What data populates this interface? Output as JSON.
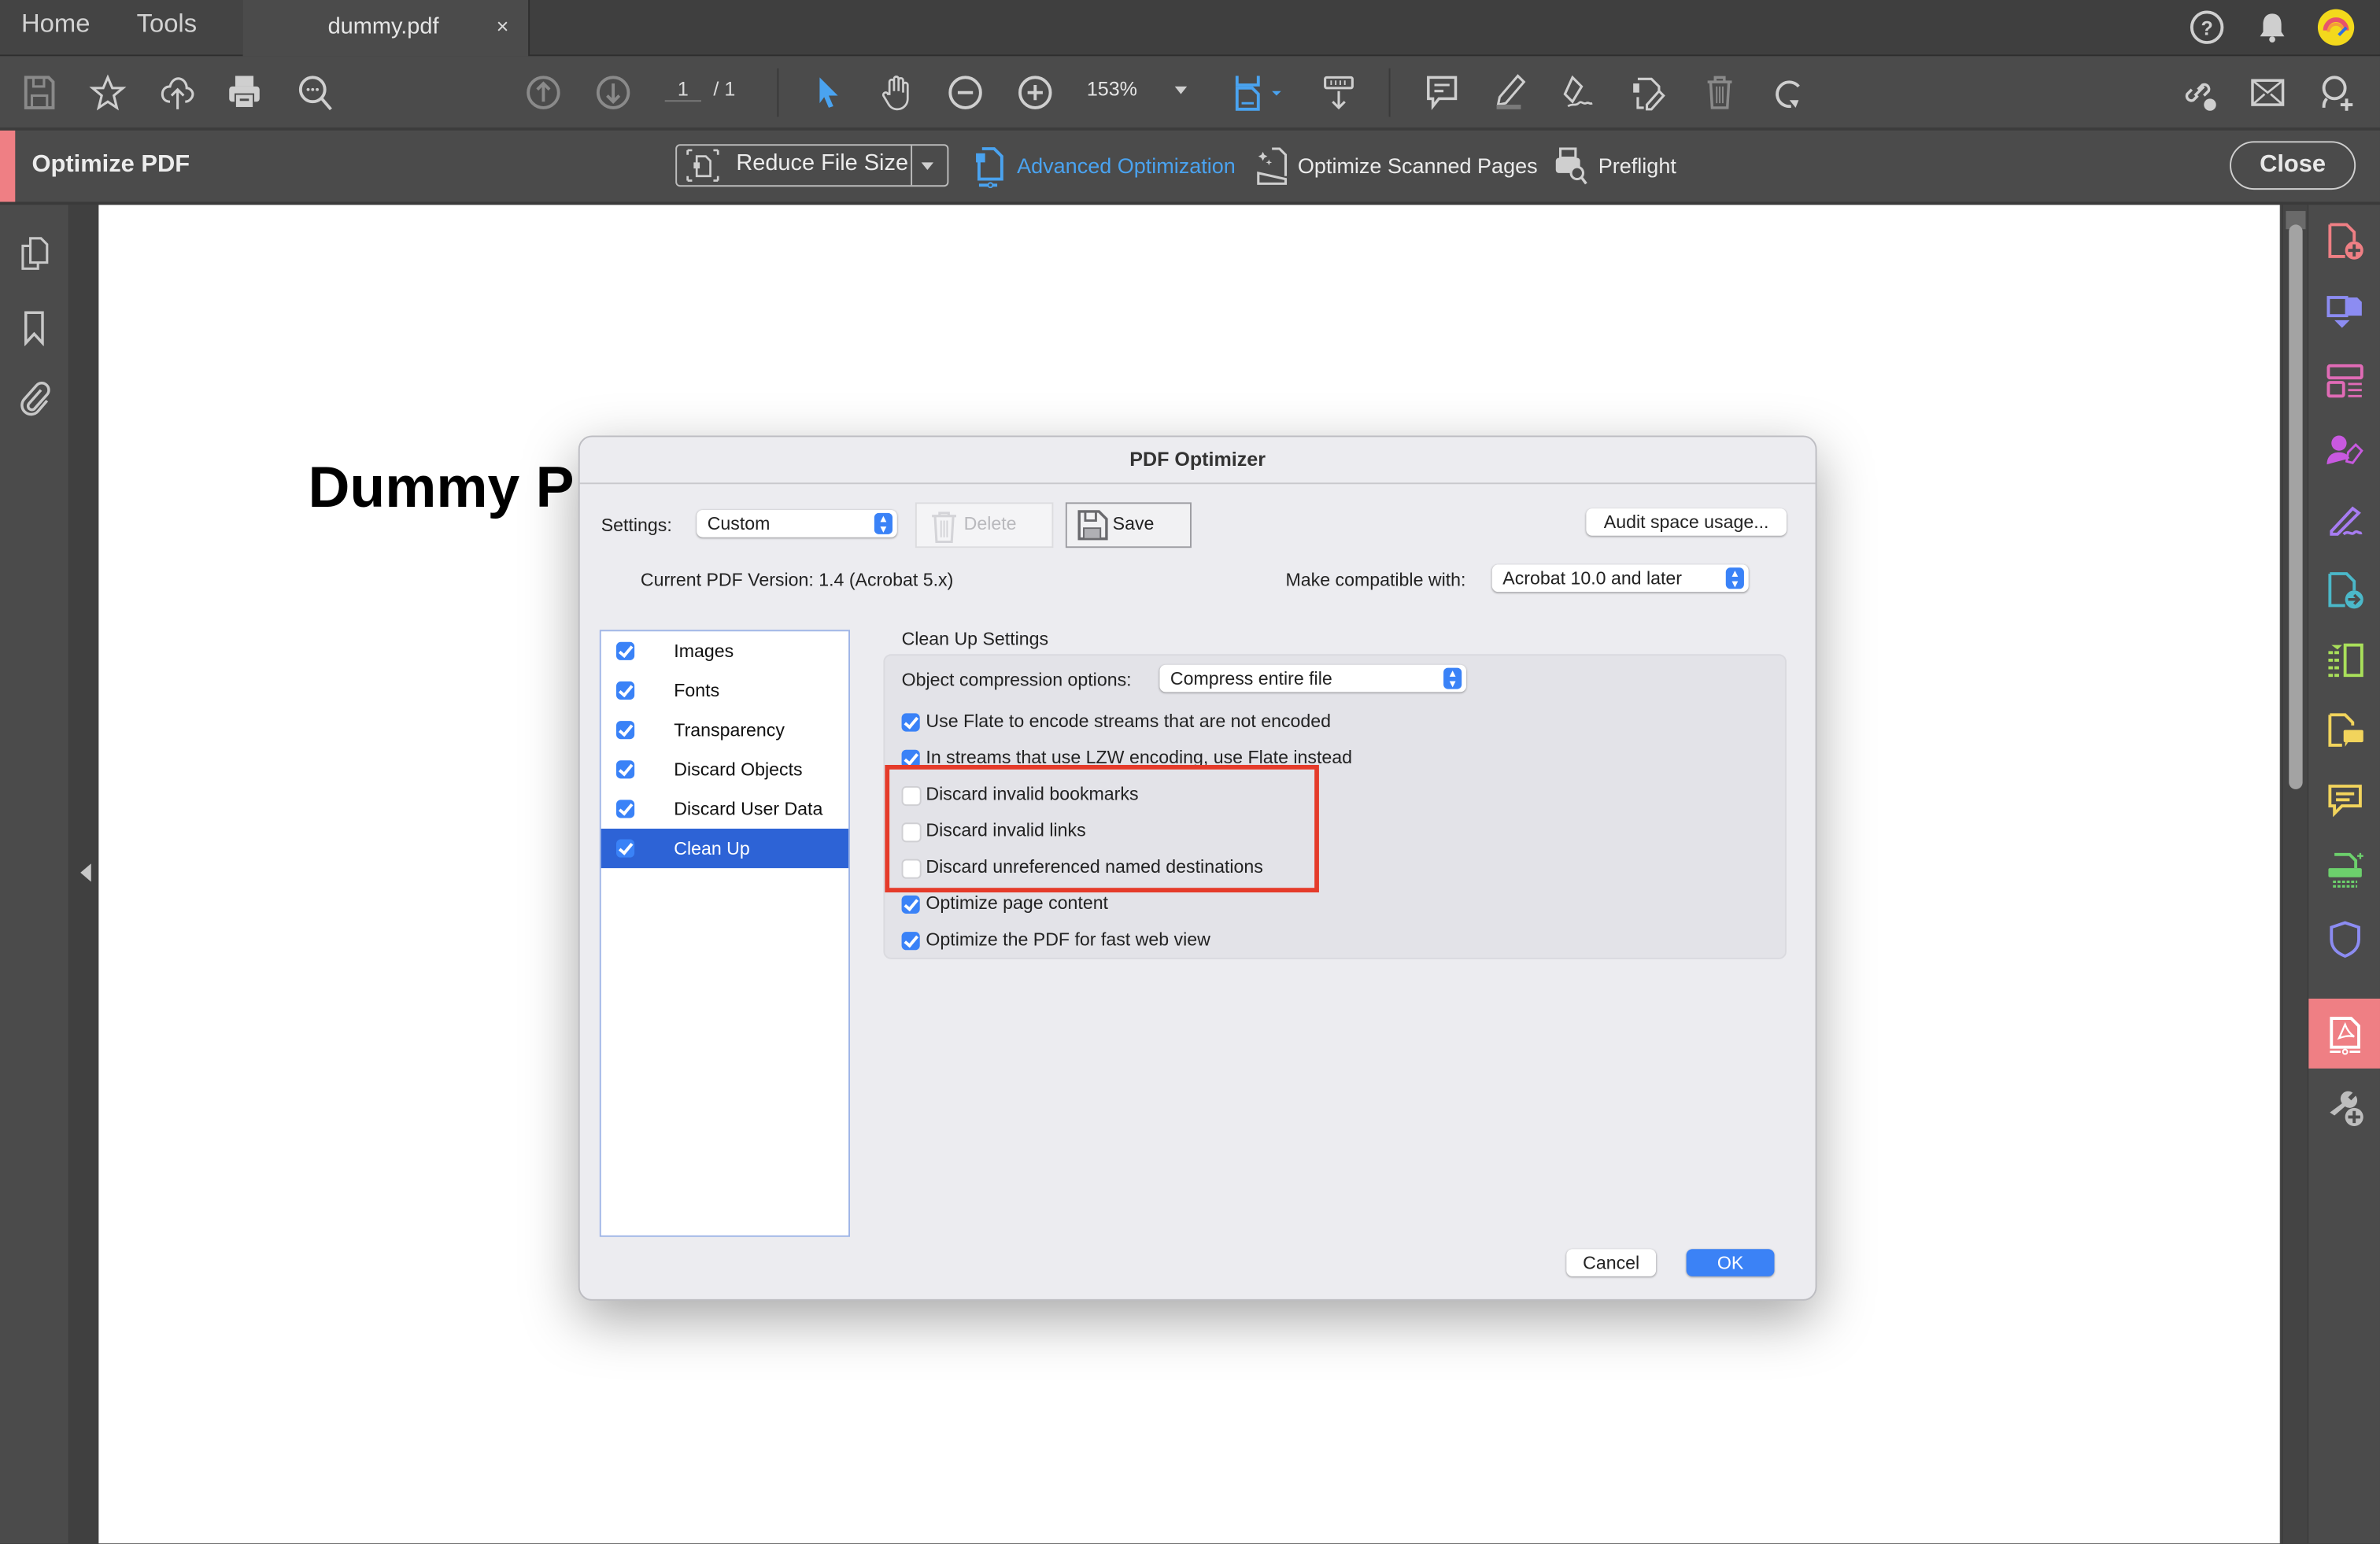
{
  "tabbar": {
    "home": "Home",
    "tools": "Tools",
    "document_tab": "dummy.pdf",
    "close_tab": "×",
    "right_icons": [
      "help-icon",
      "bell-icon",
      "account-avatar"
    ]
  },
  "toolbar": {
    "left_icons": [
      "save-icon",
      "star-icon",
      "cloud-upload-icon",
      "print-icon",
      "find-icon"
    ],
    "page_current": "1",
    "page_total": "/ 1",
    "zoom": "153%",
    "tools": [
      "select-icon",
      "hand-icon",
      "zoom-out-icon",
      "zoom-in-icon",
      "fit-page-icon",
      "scroll-mode-icon",
      "comment-icon",
      "highlight-icon",
      "sign-icon",
      "edit-icon",
      "delete-icon",
      "rotate-icon"
    ],
    "right_icons": [
      "share-link-icon",
      "email-icon",
      "add-user-icon"
    ]
  },
  "optimize_bar": {
    "title": "Optimize PDF",
    "reduce_file_size": "Reduce File Size",
    "advanced_optimization": "Advanced Optimization",
    "optimize_scanned": "Optimize Scanned Pages",
    "preflight": "Preflight",
    "close": "Close",
    "accent_color": "#ef7f84",
    "active_color": "#4aa3f0"
  },
  "document": {
    "heading_visible": "Dummy P"
  },
  "right_panel": {
    "tools": [
      {
        "name": "create-pdf",
        "color": "#ef7f84"
      },
      {
        "name": "combine-files",
        "color": "#8c8cf2"
      },
      {
        "name": "organize-pages",
        "color": "#e06bb6"
      },
      {
        "name": "request-signatures",
        "color": "#c859e0"
      },
      {
        "name": "fill-sign",
        "color": "#a77cf2"
      },
      {
        "name": "export-pdf",
        "color": "#4bb8c9"
      },
      {
        "name": "compare-files",
        "color": "#a9e05a"
      },
      {
        "name": "send-for-comments",
        "color": "#f2d45c"
      },
      {
        "name": "comment",
        "color": "#f2d45c"
      },
      {
        "name": "scan-ocr",
        "color": "#6cd06c"
      },
      {
        "name": "protect",
        "color": "#8c8cf2"
      },
      {
        "name": "optimize-pdf",
        "color": "#ffffff",
        "active": true
      },
      {
        "name": "more-tools",
        "color": "#bdbdbd"
      }
    ]
  },
  "dialog": {
    "title": "PDF Optimizer",
    "settings_label": "Settings:",
    "settings_value": "Custom",
    "delete": "Delete",
    "save": "Save",
    "audit": "Audit space usage...",
    "current_version": "Current PDF Version: 1.4 (Acrobat 5.x)",
    "compat_label": "Make compatible with:",
    "compat_value": "Acrobat 10.0 and later",
    "categories": [
      {
        "label": "Images",
        "checked": true
      },
      {
        "label": "Fonts",
        "checked": true
      },
      {
        "label": "Transparency",
        "checked": true
      },
      {
        "label": "Discard Objects",
        "checked": true
      },
      {
        "label": "Discard User Data",
        "checked": true
      },
      {
        "label": "Clean Up",
        "checked": true,
        "selected": true
      }
    ],
    "section_title": "Clean Up Settings",
    "compression_label": "Object compression options:",
    "compression_value": "Compress entire file",
    "options": [
      {
        "label": "Use Flate to encode streams that are not encoded",
        "checked": true
      },
      {
        "label": "In streams that use LZW encoding, use Flate instead",
        "checked": true
      },
      {
        "label": "Discard invalid bookmarks",
        "checked": false
      },
      {
        "label": "Discard invalid links",
        "checked": false
      },
      {
        "label": "Discard unreferenced named destinations",
        "checked": false
      },
      {
        "label": "Optimize page content",
        "checked": true
      },
      {
        "label": "Optimize the PDF for fast web view",
        "checked": true
      }
    ],
    "cancel": "Cancel",
    "ok": "OK",
    "highlight_color": "#e53b2a"
  }
}
